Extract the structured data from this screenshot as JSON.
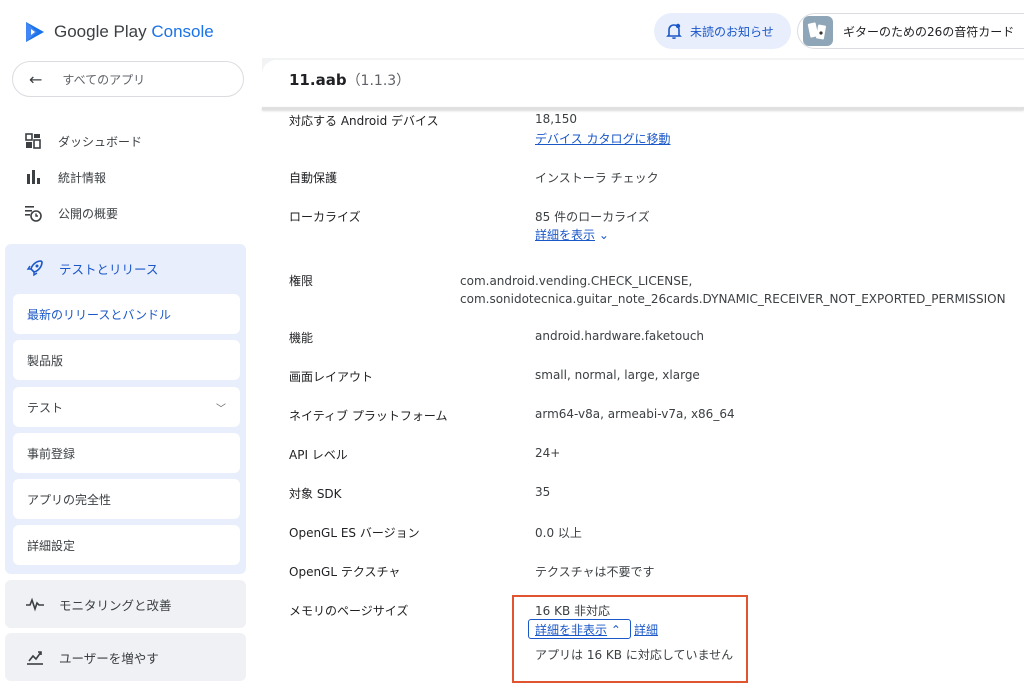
{
  "sidebar": {
    "logo_main": "Google Play",
    "logo_accent": "Console",
    "back_label": "すべてのアプリ",
    "nav": [
      "ダッシュボード",
      "統計情報",
      "公開の概要"
    ],
    "release_group_label": "テストとリリース",
    "release_items": [
      "最新のリリースとバンドル",
      "製品版",
      "テスト",
      "事前登録",
      "アプリの完全性",
      "詳細設定"
    ],
    "monitoring_label": "モニタリングと改善",
    "grow_label": "ユーザーを増やす"
  },
  "topbar": {
    "notifications_label": "未読のお知らせ",
    "app_name": "ギターのための26の音符カード"
  },
  "panel": {
    "title": "11.aab",
    "version": "（1.1.3）",
    "rows": {
      "devices_label": "対応する Android デバイス",
      "devices_value": "18,150",
      "devices_link": "デバイス カタログに移動",
      "protection_label": "自動保護",
      "protection_value": "インストーラ チェック",
      "localize_label": "ローカライズ",
      "localize_value": "85 件のローカライズ",
      "localize_link": "詳細を表示",
      "permissions_label": "権限",
      "permission_1": "com.android.vending.CHECK_LICENSE,",
      "permission_2": "com.sonidotecnica.guitar_note_26cards.DYNAMIC_RECEIVER_NOT_EXPORTED_PERMISSION",
      "features_label": "機能",
      "features_value": "android.hardware.faketouch",
      "layout_label": "画面レイアウト",
      "layout_value": "small, normal, large, xlarge",
      "platform_label": "ネイティブ プラットフォーム",
      "platform_value": "arm64-v8a, armeabi-v7a, x86_64",
      "api_label": "API レベル",
      "api_value": "24+",
      "sdk_label": "対象 SDK",
      "sdk_value": "35",
      "opengl_label": "OpenGL ES バージョン",
      "opengl_value": "0.0 以上",
      "texture_label": "OpenGL テクスチャ",
      "texture_value": "テクスチャは不要です",
      "memory_label": "メモリのページサイズ",
      "memory_value": "16 KB 非対応",
      "memory_hide_link": "詳細を非表示",
      "memory_detail_link": "詳細",
      "memory_note": "アプリは 16 KB に対応していません"
    }
  },
  "colors": {
    "accent": "#1a57c8",
    "highlight_box": "#e0552f"
  }
}
